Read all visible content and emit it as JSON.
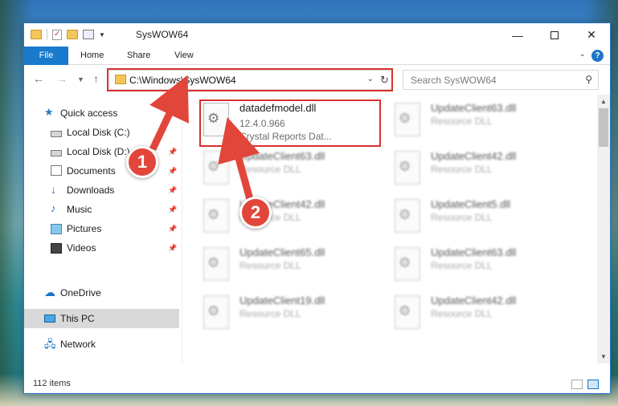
{
  "window": {
    "title": "SysWOW64",
    "accent": "#1979ca",
    "controls": {
      "minimize": "—",
      "close": "✕"
    }
  },
  "ribbon": {
    "file_tab": "File",
    "tabs": [
      "Home",
      "Share",
      "View"
    ]
  },
  "address": {
    "path": "C:\\Windows\\SysWOW64",
    "search_placeholder": "Search SysWOW64"
  },
  "sidebar": {
    "items": [
      {
        "label": "Quick access",
        "icon": "star-icon",
        "pinned": false
      },
      {
        "label": "Local Disk (C:)",
        "icon": "disk-icon",
        "pinned": false
      },
      {
        "label": "Local Disk (D:)",
        "icon": "disk-icon",
        "pinned": true
      },
      {
        "label": "Documents",
        "icon": "document-icon",
        "pinned": true
      },
      {
        "label": "Downloads",
        "icon": "download-icon",
        "pinned": true
      },
      {
        "label": "Music",
        "icon": "music-icon",
        "pinned": true
      },
      {
        "label": "Pictures",
        "icon": "pictures-icon",
        "pinned": true
      },
      {
        "label": "Videos",
        "icon": "video-icon",
        "pinned": true
      },
      {
        "label": "OneDrive",
        "icon": "cloud-icon",
        "pinned": false
      },
      {
        "label": "This PC",
        "icon": "pc-icon",
        "pinned": false,
        "selected": true
      },
      {
        "label": "Network",
        "icon": "network-icon",
        "pinned": false
      }
    ]
  },
  "files": {
    "left_column": [
      {
        "name": "datadefmodel.dll",
        "line2": "12.4.0.966",
        "line3": "Crystal Reports Dat...",
        "blurred": false
      },
      {
        "name": "UpdateClient63.dll",
        "line2": "Resource DLL",
        "blurred": true
      },
      {
        "name": "UpdateClient42.dll",
        "line2": "Resource DLL",
        "blurred": true
      },
      {
        "name": "UpdateClient65.dll",
        "line2": "Resource DLL",
        "blurred": true
      },
      {
        "name": "UpdateClient19.dll",
        "line2": "Resource DLL",
        "blurred": true
      }
    ],
    "right_column": [
      {
        "name": "UpdateClient63.dll",
        "line2": "Resource DLL",
        "blurred": true
      },
      {
        "name": "UpdateClient42.dll",
        "line2": "Resource DLL",
        "blurred": true
      },
      {
        "name": "UpdateClient5.dll",
        "line2": "Resource DLL",
        "blurred": true
      },
      {
        "name": "UpdateClient63.dll",
        "line2": "Resource DLL",
        "blurred": true
      },
      {
        "name": "UpdateClient42.dll",
        "line2": "Resource DLL",
        "blurred": true
      }
    ]
  },
  "status": {
    "item_count": "112 items"
  },
  "annotations": {
    "step1": "1",
    "step2": "2",
    "color": "#e2463b"
  }
}
